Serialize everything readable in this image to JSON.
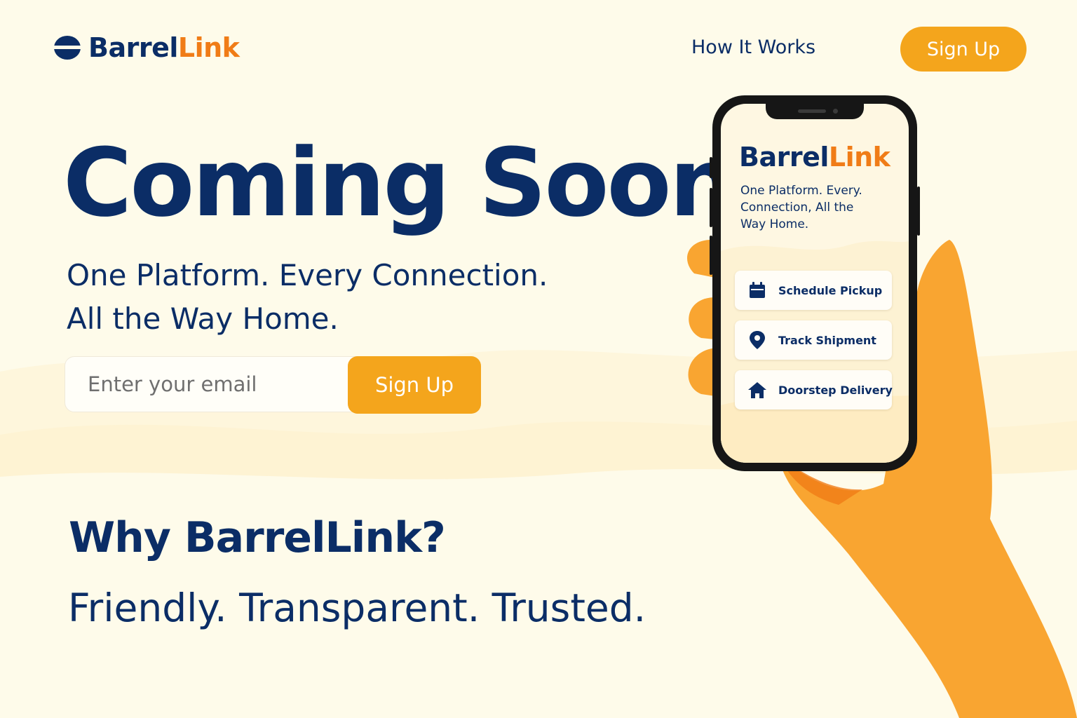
{
  "colors": {
    "navy": "#0b2d66",
    "brand_orange": "#f07c17",
    "button_amber": "#f4a51c",
    "background": "#fefbea"
  },
  "header": {
    "logo": {
      "part1": "Barrel",
      "part2": "Link",
      "icon": "barrel-icon"
    },
    "nav_link": "How It Works",
    "signup_label": "Sign Up"
  },
  "hero": {
    "title": "Coming Soon",
    "tagline_line1": "One Platform. Every Connection.",
    "tagline_line2": "All the Way Home.",
    "email_placeholder": "Enter your email",
    "signup_label": "Sign Up"
  },
  "why": {
    "heading": "Why BarrelLink?",
    "subheading": "Friendly.  Transparent. Trusted."
  },
  "phone": {
    "logo_part1": "Barrel",
    "logo_part2": "Link",
    "tagline_lines": [
      "One Platform. Every.",
      "Connection, All the",
      "Way Home."
    ],
    "features": [
      {
        "label": "Schedule Pickup",
        "icon": "calendar-icon"
      },
      {
        "label": "Track Shipment",
        "icon": "location-pin-icon"
      },
      {
        "label": "Doorstep Delivery",
        "icon": "home-icon"
      }
    ]
  }
}
